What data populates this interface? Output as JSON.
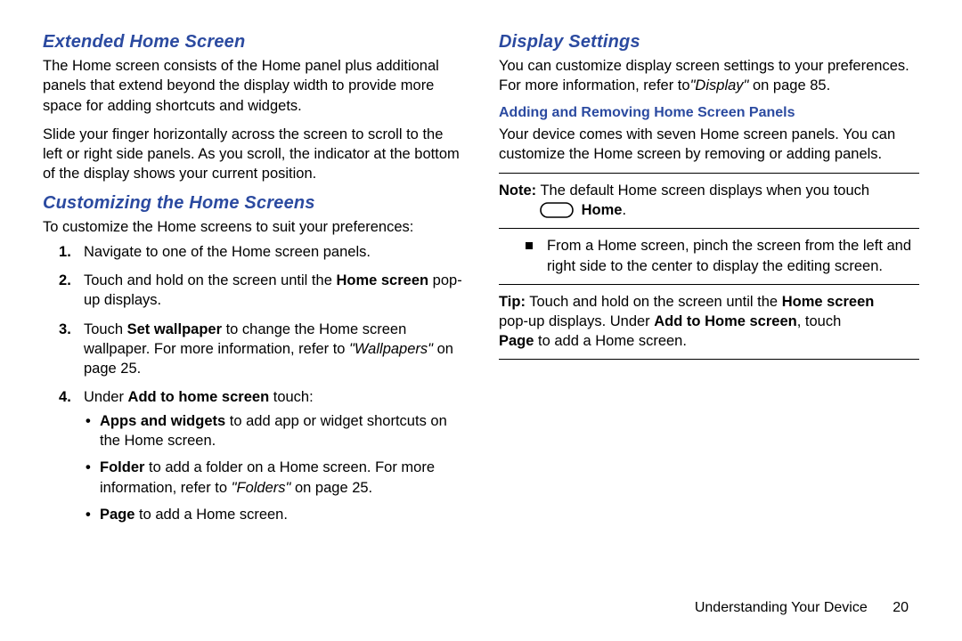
{
  "left": {
    "h1": "Extended Home Screen",
    "p1": "The Home screen consists of the Home panel plus additional panels that extend beyond the display width to provide more space for adding shortcuts and widgets.",
    "p2": "Slide your finger horizontally across the screen to scroll to the left or right side panels. As you scroll, the indicator at the bottom of the display shows your current position.",
    "h2": "Customizing the Home Screens",
    "intro": "To customize the Home screens to suit your preferences:",
    "s1": "Navigate to one of the Home screen panels.",
    "s2a": "Touch and hold on the screen until the ",
    "s2b": "Home screen",
    "s2c": " pop-up displays.",
    "s3a": "Touch ",
    "s3b": "Set wallpaper",
    "s3c": " to change the Home screen wallpaper. For more information, refer to ",
    "s3d": "\"Wallpapers\"",
    "s3e": " on page 25.",
    "s4a": "Under ",
    "s4b": "Add to home screen",
    "s4c": " touch:",
    "b1a": "Apps and widgets",
    "b1b": " to add app or widget shortcuts on the Home screen.",
    "b2a": "Folder",
    "b2b": " to add a folder on a Home screen. For more information, refer to ",
    "b2c": "\"Folders\"",
    "b2d": " on page 25.",
    "b3a": "Page",
    "b3b": " to add a Home screen."
  },
  "right": {
    "h1": "Display Settings",
    "p1a": "You can customize display screen settings to your preferences. For more information, refer to",
    "p1b": "\"Display\"",
    "p1c": " on page 85.",
    "h2": "Adding and Removing Home Screen Panels",
    "p2": "Your device comes with seven Home screen panels. You can customize the Home screen by removing or adding panels.",
    "note1a": "Note:",
    "note1b": " The default Home screen displays when you touch",
    "note1home": "Home",
    "note1dot": ".",
    "sq1": "From a Home screen, pinch the screen from the left and right side to the center to display the editing screen.",
    "tip_a": "Tip:",
    "tip_b": " Touch and hold on the screen until the ",
    "tip_c": "Home screen",
    "tip_d": " pop-up displays. Under ",
    "tip_e": "Add to Home screen",
    "tip_f": ", touch ",
    "tip_g": "Page",
    "tip_h": " to add a Home screen."
  },
  "footer": {
    "section": "Understanding Your Device",
    "page": "20"
  }
}
